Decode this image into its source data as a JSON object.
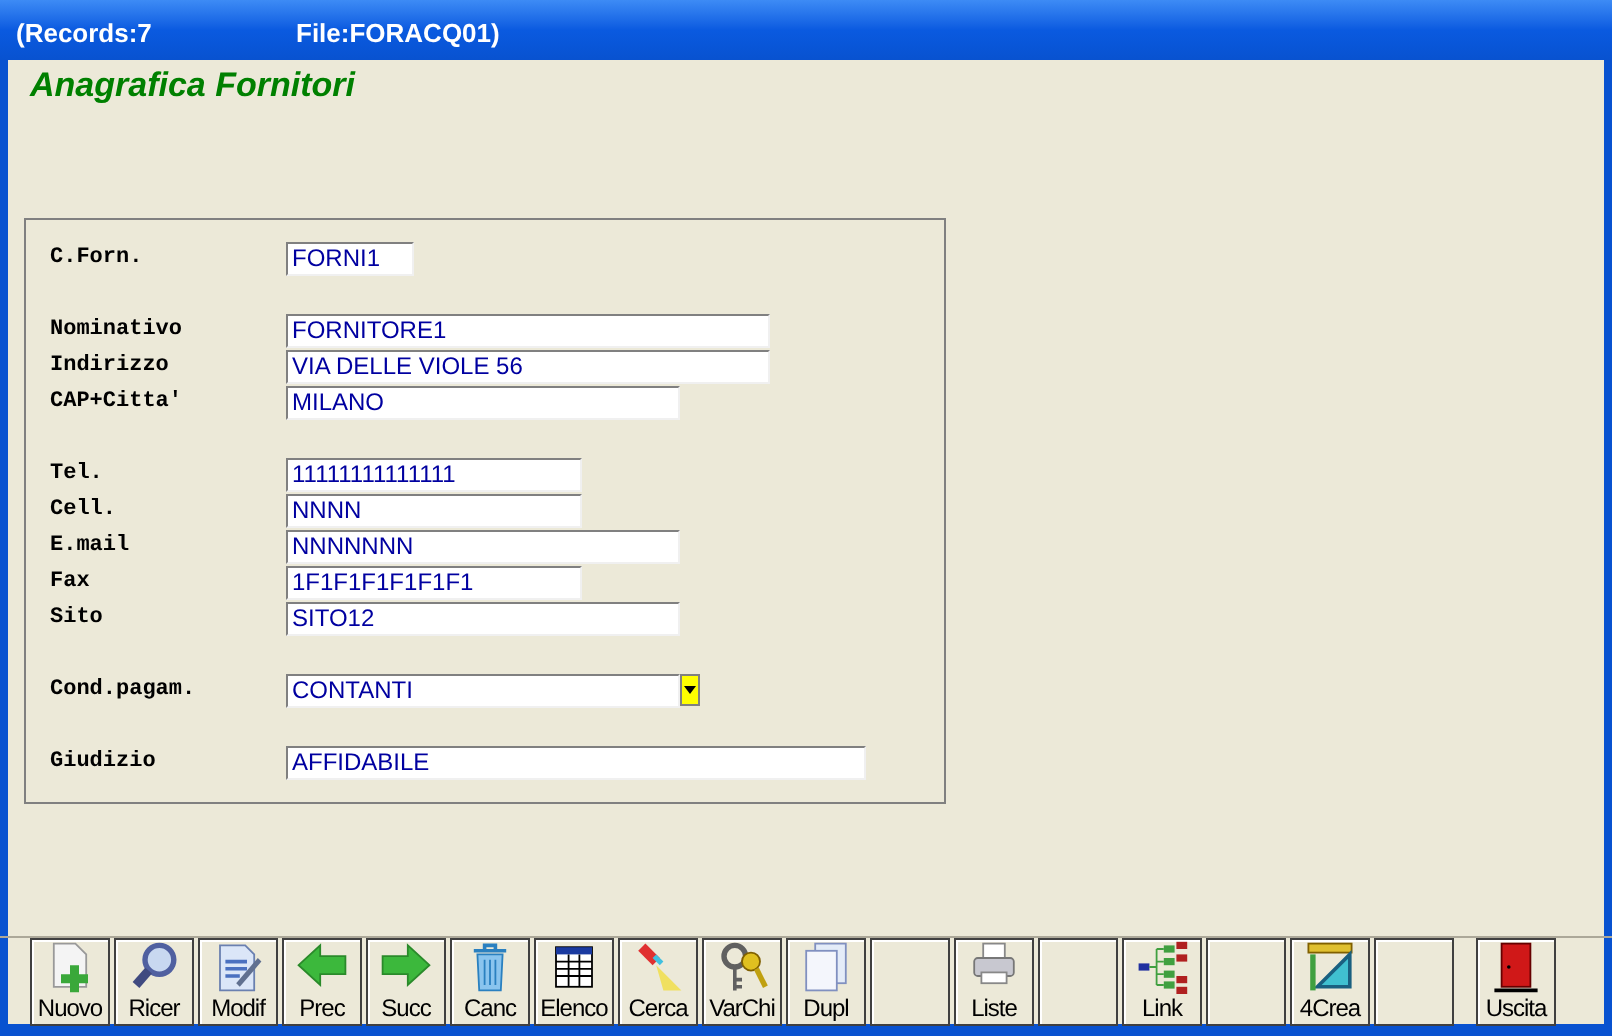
{
  "window": {
    "records": "(Records:7",
    "file": "File:FORACQ01)"
  },
  "heading": "Anagrafica Fornitori",
  "form_groups": [
    [
      {
        "label": "C.Forn.",
        "value": "FORNI1",
        "kind": "text"
      }
    ],
    [
      {
        "label": "Nominativo",
        "value": "FORNITORE1",
        "kind": "text"
      },
      {
        "label": "Indirizzo",
        "value": "VIA DELLE VIOLE 56",
        "kind": "text"
      },
      {
        "label": "CAP+Citta'",
        "value": "MILANO",
        "kind": "text"
      }
    ],
    [
      {
        "label": "Tel.",
        "value": "11111111111111",
        "kind": "text"
      },
      {
        "label": "Cell.",
        "value": "NNNN",
        "kind": "text"
      },
      {
        "label": "E.mail",
        "value": "NNNNNNN",
        "kind": "text"
      },
      {
        "label": "Fax",
        "value": "1F1F1F1F1F1F1",
        "kind": "text"
      },
      {
        "label": "Sito",
        "value": "SITO12",
        "kind": "text"
      }
    ],
    [
      {
        "label": "Cond.pagam.",
        "value": "CONTANTI",
        "kind": "dropdown"
      }
    ],
    [
      {
        "label": "Giudizio",
        "value": "AFFIDABILE",
        "kind": "text"
      }
    ]
  ],
  "toolbar": [
    {
      "label": "Nuovo",
      "kind": "new"
    },
    {
      "label": "Ricer",
      "kind": "magnifier"
    },
    {
      "label": "Modif",
      "kind": "edit"
    },
    {
      "label": "Prec",
      "kind": "prev"
    },
    {
      "label": "Succ",
      "kind": "next"
    },
    {
      "label": "Canc",
      "kind": "trash"
    },
    {
      "label": "Elenco",
      "kind": "table"
    },
    {
      "label": "Cerca",
      "kind": "flashlight"
    },
    {
      "label": "VarChi",
      "kind": "keys"
    },
    {
      "label": "Dupl",
      "kind": "pages"
    },
    {
      "kind": "blank"
    },
    {
      "label": "Liste",
      "kind": "printer"
    },
    {
      "kind": "blank"
    },
    {
      "label": "Link",
      "kind": "tree"
    },
    {
      "kind": "blank"
    },
    {
      "label": "4Crea",
      "kind": "ruler"
    },
    {
      "kind": "blank"
    },
    {
      "label": "Uscita",
      "kind": "door"
    }
  ]
}
